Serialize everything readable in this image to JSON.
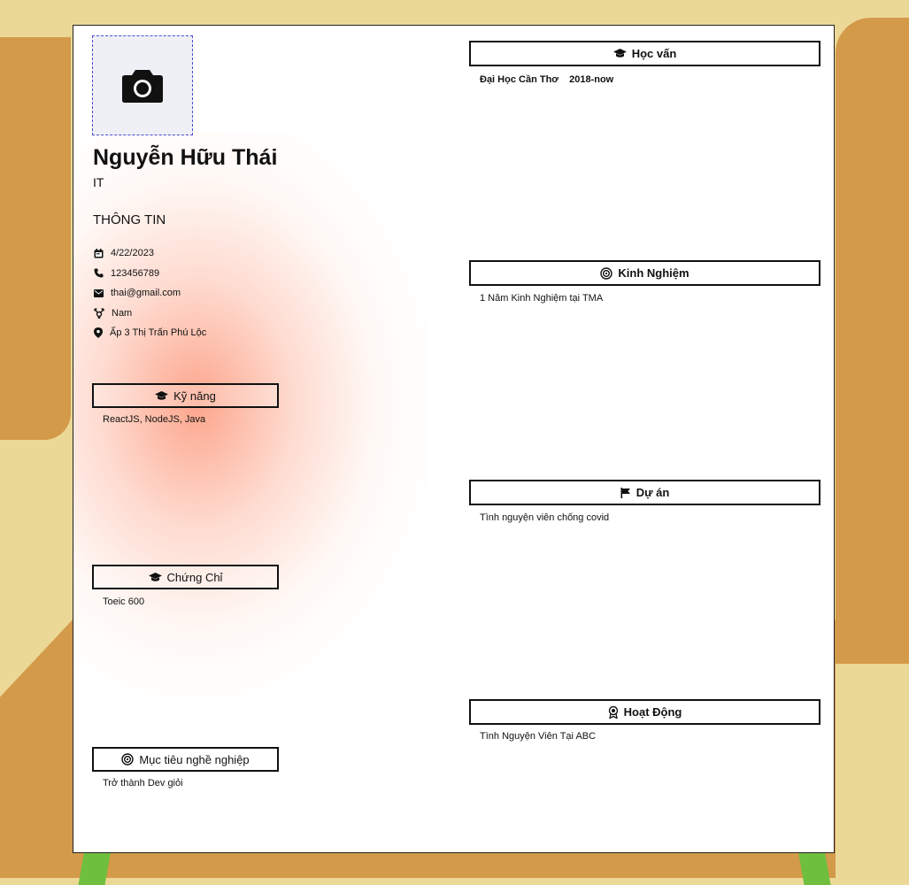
{
  "profile": {
    "name": "Nguyễn Hữu Thái",
    "role": "IT"
  },
  "info": {
    "title": "THÔNG TIN",
    "items": [
      {
        "icon": "calendar-icon",
        "value": "4/22/2023"
      },
      {
        "icon": "phone-icon",
        "value": "123456789"
      },
      {
        "icon": "mail-icon",
        "value": "thai@gmail.com"
      },
      {
        "icon": "gender-icon",
        "value": "Nam"
      },
      {
        "icon": "location-icon",
        "value": "Ấp 3 Thị Trấn Phú Lộc"
      }
    ]
  },
  "skills": {
    "title": "Kỹ năng",
    "content": "ReactJS, NodeJS,  Java"
  },
  "certificates": {
    "title": "Chứng Chỉ",
    "content": "Toeic 600"
  },
  "objective": {
    "title": "Mục tiêu nghề nghiệp",
    "content": "Trở thành Dev giỏi"
  },
  "education": {
    "title": "Học vấn",
    "school": "Đại Học Cần Thơ",
    "period": "2018-now"
  },
  "experience": {
    "title": "Kinh Nghiệm",
    "content": "1 Năm Kinh Nghiệm tại TMA"
  },
  "projects": {
    "title": "Dự án",
    "content": "Tình nguyện viên chống covid"
  },
  "activities": {
    "title": "Hoạt Động",
    "content": "Tình Nguyện Viên Tại ABC"
  },
  "colors": {
    "background": "#ecd896",
    "accent_blob": "#d39a4a",
    "glow": "#fc9678",
    "border": "#111111"
  }
}
